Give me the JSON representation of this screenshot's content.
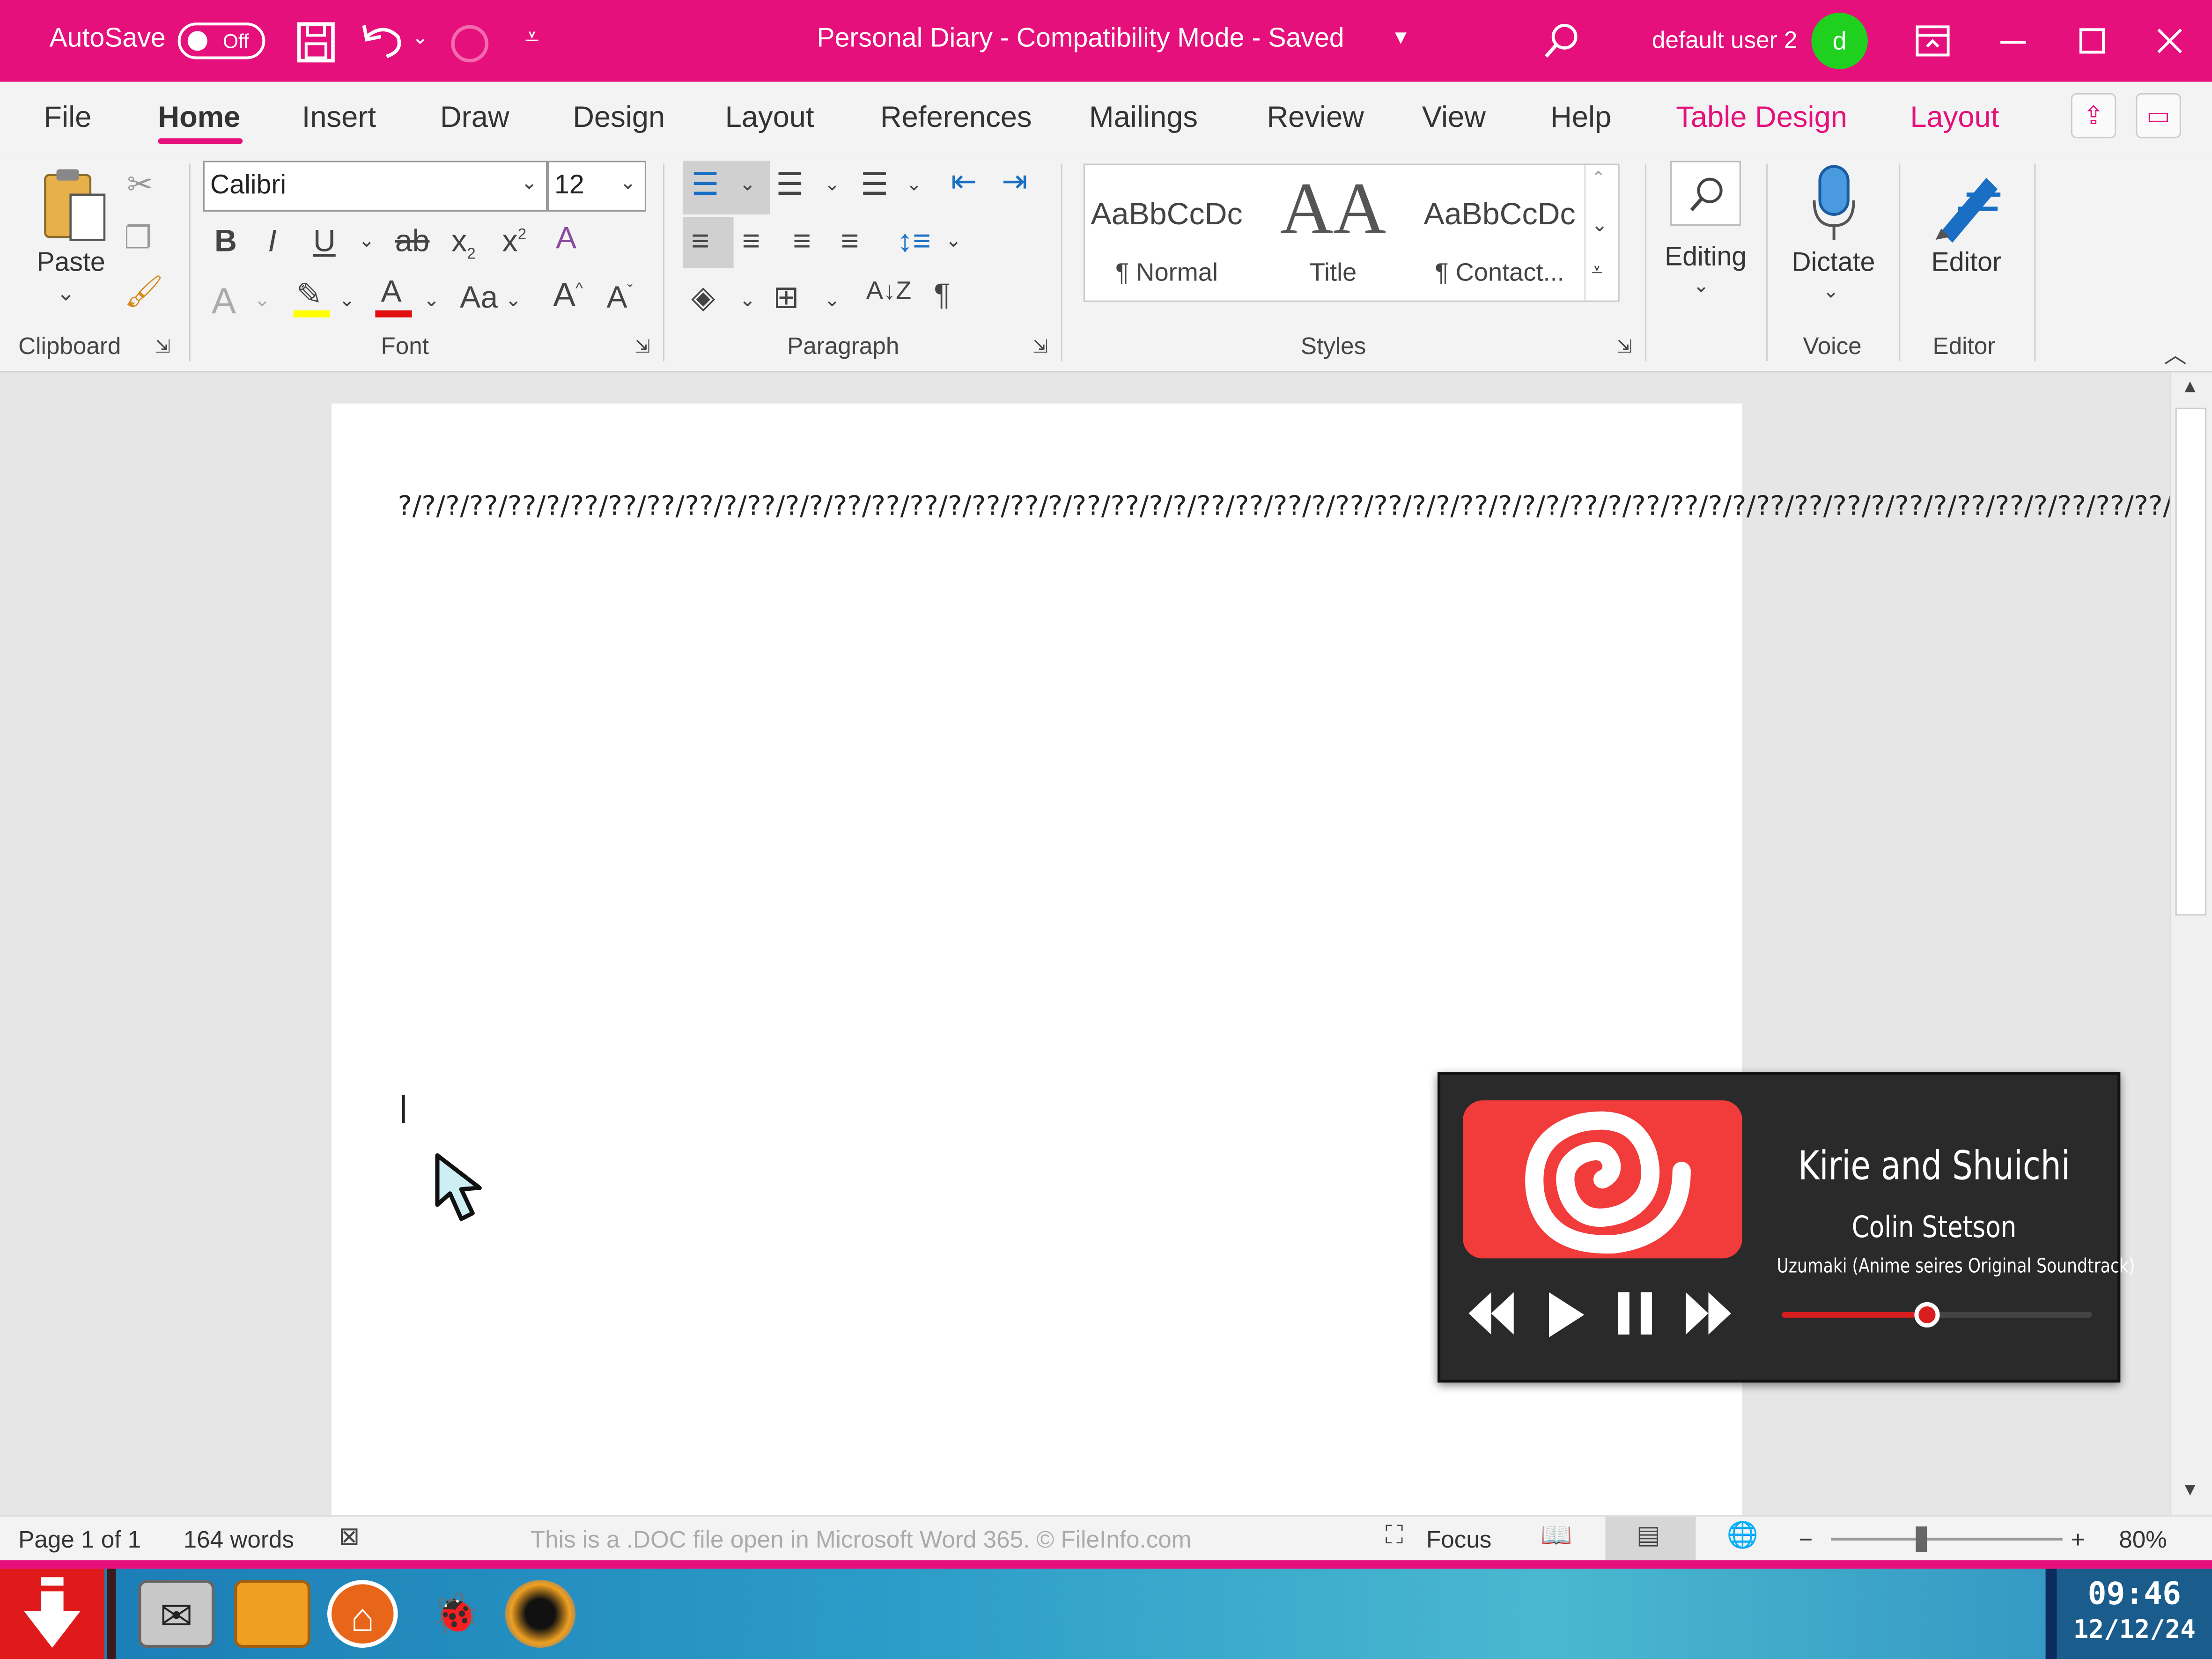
{
  "window": {
    "autosave_label": "AutoSave",
    "autosave_state": "Off",
    "title": "Personal Diary -  Compatibility Mode  -  Saved",
    "user_name": "default user 2",
    "user_initial": "d"
  },
  "menu": {
    "tabs": [
      "File",
      "Home",
      "Insert",
      "Draw",
      "Design",
      "Layout",
      "References",
      "Mailings",
      "Review",
      "View",
      "Help",
      "Table Design",
      "Layout"
    ],
    "active_tab": "Home"
  },
  "ribbon": {
    "paste_label": "Paste",
    "font_name": "Calibri",
    "font_size": "12",
    "styles": [
      {
        "sample": "AaBbCcDc",
        "name": "¶ Normal"
      },
      {
        "sample": "AA",
        "name": "Title"
      },
      {
        "sample": "AaBbCcDc",
        "name": "¶ Contact..."
      }
    ],
    "editing_label": "Editing",
    "dictate_label": "Dictate",
    "editor_label": "Editor",
    "groups": [
      "Clipboard",
      "Font",
      "Paragraph",
      "Styles",
      "Voice",
      "Editor"
    ]
  },
  "document": {
    "text": "?/?/?/??/??/?/??/??/??/??/?/??/?/?/??/??/??/?/??/??/?/??/??/?/?/??/??/??/?/??/??/?/?/??/?/?/?/??/?/??/??/?/?/??/??/??/?/??/?/??/??/?/??/??/??/??/?/??/?/?/?/?/??/?/??/??/?/??/?/?/?/??/?/??/??/??/?/?/?/?/??/?/?/??/??/??/??/??/?/??/?/??/?/??/?/??/?/??/?/??/??/?/??/?/?/?/??/?/?/??/?/?/??/?/??/?/??/??/?/?/?/??/??/??/?/??/?/??/??/?/?/?/??/??/?/??/?/??/??/??/?/??/?/??/?/??/??/?/??/?/?/?/??/??/?/??/?/??/?/?/??/??/?/??/?/??/??/??/??/?/??/??/?/?/?/??/??/??/??/?/??/?/?/?/??/??/?/??/?/?/??/??/?/?/?/??/?/??/?/??/??/??/??/?/??/??/??/?/?/??/??/?/?/?/??/?/?/?/?/?/??/??/?/?/??/??/??/??/??/??/??/?/?/??/??/?/??/?/?/?/?/?/?/??/??/?/??/?/??/??/?/?/?/?/??/??/??/?/?/?/??/??/?/?/?/??/??/??/?/??/?/?/?/?/??/??/?/??/??/??/??/??/??/?/??/??/??/??/??/??/??/?/??/?/??/??/??/??/?/?/??/??/??/??/??/?/?/?/?/?/??/??/??/??/??/?/??/??/?/??/??/??/??/?/?/?/?/?/?/?/??/??/??/?/?/?/??/?/??/?/?/?/??/??/??/??/??/??/??/?/??/?/??/??/??/??/??/?/??/?/??/?/??/??/?/??/??/?/?/?/?/?/??/?/??/??/??/?/?/?/??/??/??/??/?/?/?/??/??/??/??"
  },
  "statusbar": {
    "page": "Page 1 of 1",
    "words": "164 words",
    "info": "This is a .DOC file open in Microsoft Word 365. © FileInfo.com",
    "focus": "Focus",
    "zoom": "80%",
    "zoom_minus": "−",
    "zoom_plus": "+"
  },
  "media_player": {
    "track": "Kirie and Shuichi",
    "artist": "Colin Stetson",
    "album": "Uzumaki (Anime seires Original Soundtrack)",
    "progress_fraction": 0.47
  },
  "taskbar": {
    "time": "09:46",
    "date": "12/12/24"
  },
  "colors": {
    "brand_pink": "#e5107c",
    "avatar_green": "#1fd01f",
    "player_red": "#d81e1e"
  }
}
